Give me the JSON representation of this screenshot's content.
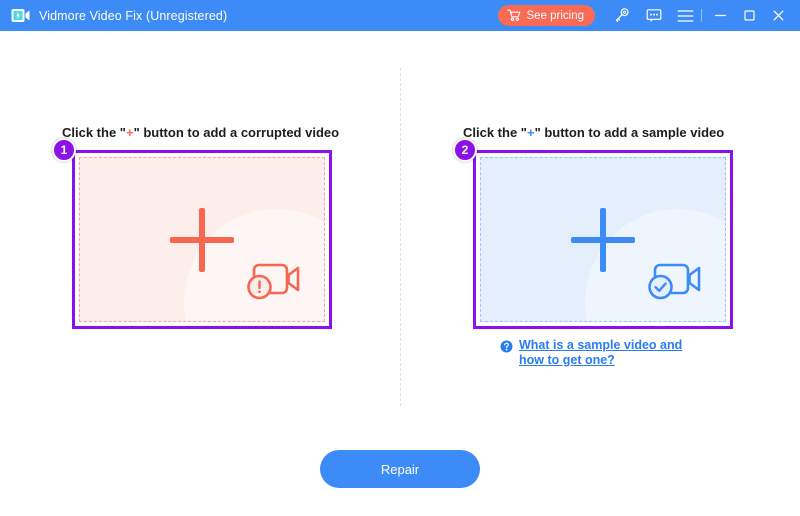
{
  "window": {
    "title": "Vidmore Video Fix (Unregistered)",
    "logo_icon": "video-camera-logo-icon",
    "pricing_button": {
      "label": "See pricing",
      "icon": "shopping-cart-icon",
      "color": "#fa6a55"
    },
    "toolbar_icons": [
      {
        "name": "key-icon",
        "glyph": "key"
      },
      {
        "name": "feedback-icon",
        "glyph": "speech-bubble"
      },
      {
        "name": "menu-icon",
        "glyph": "hamburger"
      }
    ],
    "controls": [
      {
        "name": "minimize-button",
        "glyph": "minimize"
      },
      {
        "name": "maximize-button",
        "glyph": "maximize"
      },
      {
        "name": "close-button",
        "glyph": "close"
      }
    ],
    "titlebar_color": "#3d8bf7"
  },
  "main": {
    "left_panel": {
      "badge": "1",
      "label_before": "Click the \"",
      "label_plus": "+",
      "label_after": "\" button to add a corrupted video",
      "accent_color": "#f7674f",
      "border_color": "#8c10e8",
      "fill_color": "#fdeeeb",
      "plus_icon": "plus-icon",
      "status_icon": "video-camera-error-icon"
    },
    "right_panel": {
      "badge": "2",
      "label_before": "Click the \"",
      "label_plus": "+",
      "label_after": "\" button to add a sample video",
      "accent_color": "#3d8bf7",
      "border_color": "#8c10e8",
      "fill_color": "#e4eefc",
      "plus_icon": "plus-icon",
      "status_icon": "video-camera-check-icon",
      "help_link": {
        "text": "What is a sample video and how to get one?",
        "icon": "question-mark-circle-icon",
        "color": "#2b7cf2"
      }
    },
    "repair_button": {
      "label": "Repair",
      "color": "#3d8bf7"
    }
  }
}
